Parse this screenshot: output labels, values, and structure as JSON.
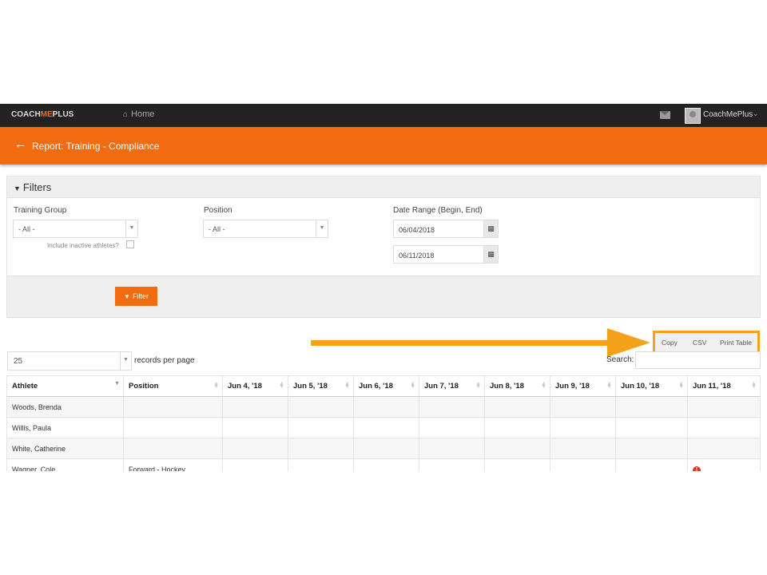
{
  "navbar": {
    "logo_a": "COACH",
    "logo_b": "ME",
    "logo_c": "PLUS",
    "home_icon": "home-icon",
    "home_label": "Home",
    "user_name": "CoachMePlus"
  },
  "header": {
    "back_icon": "←",
    "title": "Report: Training - Compliance"
  },
  "filters": {
    "title": "Filters",
    "training_group_label": "Training Group",
    "training_group_value": "- All -",
    "include_inactive_label": "Include inactive athletes?",
    "position_label": "Position",
    "position_value": "- All -",
    "date_range_label": "Date Range (Begin, End)",
    "date_begin": "06/04/2018",
    "date_end": "06/11/2018",
    "filter_button": "Filter"
  },
  "controls": {
    "copy_button": "Copy",
    "csv_button": "CSV",
    "print_button": "Print Table",
    "page_length_value": "25",
    "records_label": "records per page",
    "search_label": "Search:"
  },
  "table": {
    "columns": [
      "Athlete",
      "Position",
      "Jun 4, '18",
      "Jun 5, '18",
      "Jun 6, '18",
      "Jun 7, '18",
      "Jun 8, '18",
      "Jun 9, '18",
      "Jun 10, '18",
      "Jun 11, '18"
    ],
    "rows": [
      [
        "Woods, Brenda",
        "",
        "",
        "",
        "",
        "",
        "",
        "",
        "",
        ""
      ],
      [
        "Willis, Paula",
        "",
        "",
        "",
        "",
        "",
        "",
        "",
        "",
        ""
      ],
      [
        "White, Catherine",
        "",
        "",
        "",
        "",
        "",
        "",
        "",
        "",
        ""
      ],
      [
        "Wagner, Cole",
        "Forward - Hockey",
        "",
        "",
        "",
        "",
        "",
        "",
        "",
        "!"
      ]
    ]
  },
  "colors": {
    "brand_orange": "#f26b0f",
    "annotation_orange": "#f5a21b",
    "navbar_dark": "#222222"
  }
}
